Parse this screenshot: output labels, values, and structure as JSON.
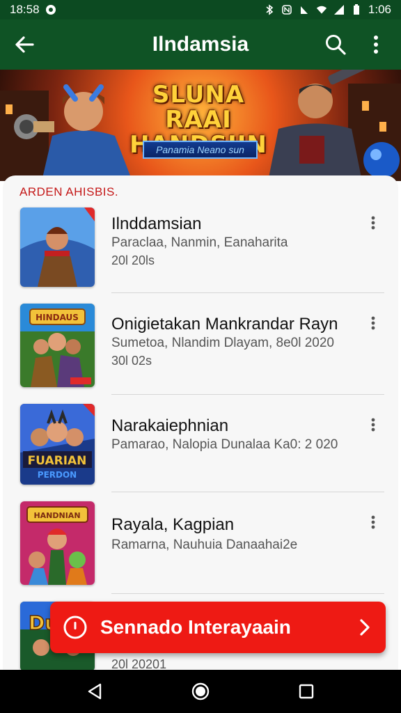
{
  "status_bar": {
    "time": "18:58",
    "clock_right": "1:06"
  },
  "app_bar": {
    "title": "Ilndamsia"
  },
  "banner": {
    "title_line1": "SLUNA RAAI",
    "title_line2": "HANDSIIN",
    "subtitle": "Panamia Neano sun"
  },
  "section_label": "ARDEN AHISBIS.",
  "items": [
    {
      "title": "Ilnddamsian",
      "subtitle": "Paraclaa, Nanmin, Eanaharita",
      "meta": "20l 20ls"
    },
    {
      "title": "Onigietakan Mankrandar Rayn",
      "subtitle": "Sumetoa, Nlandim Dlayam, 8e0l 2020",
      "meta": "30l 02s"
    },
    {
      "title": "Narakaiephnian",
      "subtitle": "Pamarao, Nalopia Dunalaa Ka0: 2 020",
      "meta": ""
    },
    {
      "title": "Rayala, Kagpian",
      "subtitle": "Ramarna, Nauhuia Danaahai2e",
      "meta": ""
    },
    {
      "title": "",
      "subtitle": "",
      "meta": "20l 20201"
    }
  ],
  "thumb_labels": {
    "t2_banner": "HINDAUS",
    "t3_banner": "FUARIAN",
    "t3_sub": "PERDON",
    "t4_banner": "HANDNIAN",
    "t5_banner": "Dul"
  },
  "cta": {
    "label": "Sennado Interayaain"
  },
  "colors": {
    "app_bar": "#0f5325",
    "status_bar": "#0c4a21",
    "accent_red": "#ee1a14",
    "section_label": "#c41818"
  },
  "icons": {
    "back": "arrow-left-icon",
    "search": "search-icon",
    "menu": "more-vert-icon",
    "cta": "info-circle-icon",
    "chevron": "chevron-right-icon"
  }
}
